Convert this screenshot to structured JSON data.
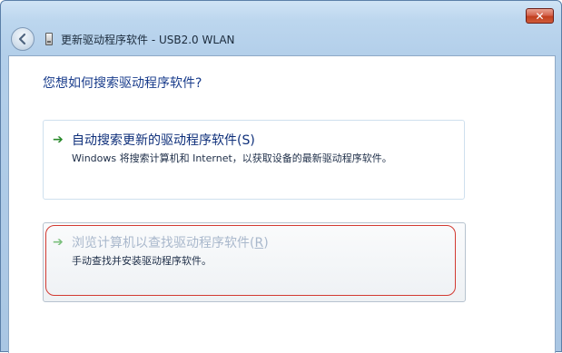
{
  "window": {
    "title": "更新驱动程序软件 - USB2.0 WLAN",
    "close_glyph": "✕",
    "back_glyph": "◀"
  },
  "main": {
    "question": "您想如何搜索驱动程序软件?",
    "options": [
      {
        "title": "自动搜索更新的驱动程序软件(S)",
        "description": "Windows 将搜索计算机和 Internet，以获取设备的最新驱动程序软件。",
        "arrow": "➔"
      },
      {
        "title_prefix": "浏览计算机以查找驱动程序软件(",
        "title_key": "R",
        "title_suffix": ")",
        "description": "手动查找并安装驱动程序软件。",
        "arrow": "➔",
        "highlighted": true
      }
    ]
  },
  "colors": {
    "highlight_border": "#d23a32",
    "link_title": "#0e2f7a",
    "question_text": "#1a3d8c",
    "arrow_green": "#2a8a2c"
  }
}
